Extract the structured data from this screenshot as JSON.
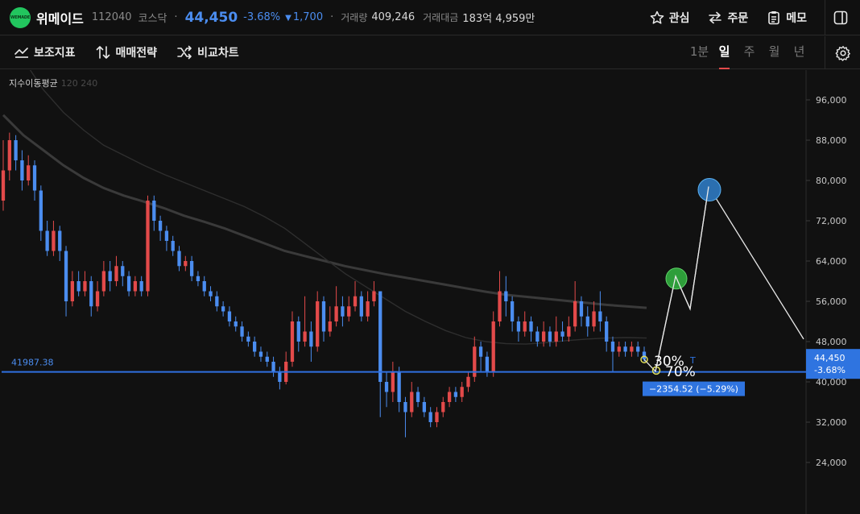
{
  "header": {
    "logo_text": "WEMADE",
    "name": "위메이드",
    "code": "112040",
    "market": "코스닥",
    "price": "44,450",
    "change_rate": "-3.68%",
    "change_arrow": "▼",
    "change_amount": "1,700",
    "volume_label": "거래량",
    "volume": "409,246",
    "turnover_label": "거래대금",
    "turnover": "183억 4,959만",
    "actions": {
      "watch": "관심",
      "order": "주문",
      "memo": "메모"
    }
  },
  "toolbar": {
    "indicators": "보조지표",
    "strategy": "매매전략",
    "compare": "비교차트",
    "periods": [
      "1분",
      "일",
      "주",
      "월",
      "년"
    ],
    "active_period": "일"
  },
  "colors": {
    "up": "#e34a4a",
    "down": "#4b8df0",
    "background": "#111111",
    "hline": "#2f6fe0",
    "ma_long": "#3a3a3a",
    "wave_green": "#2e9e3a",
    "wave_blue": "#2b6fb0"
  },
  "chart_data": {
    "type": "candlestick",
    "legend": {
      "title": "지수이동평균",
      "periods": "120 240"
    },
    "y_axis": {
      "ticks": [
        "96,000",
        "88,000",
        "80,000",
        "72,000",
        "64,000",
        "56,000",
        "48,000",
        "40,000",
        "32,000",
        "24,000"
      ],
      "tick_values": [
        96000,
        88000,
        80000,
        72000,
        64000,
        56000,
        48000,
        40000,
        32000,
        24000
      ],
      "range": [
        20000,
        100000
      ]
    },
    "current_price": {
      "value": 44450,
      "label": "44,450",
      "change": "-3.68%"
    },
    "horizontal_line": {
      "value": 41987.38,
      "label": "41987.38"
    },
    "measure_label": "−2354.52 (−5.29%)",
    "fib_labels": [
      "30%",
      "70%"
    ],
    "projection_path": [
      44450,
      42100,
      61000,
      54500,
      78800,
      48500
    ],
    "ma120": [
      93000,
      89000,
      86000,
      83000,
      80500,
      78500,
      77000,
      75800,
      74500,
      73000,
      71800,
      70500,
      69000,
      67500,
      66000,
      65000,
      64000,
      63000,
      62200,
      61400,
      60700,
      60000,
      59300,
      58600,
      57900,
      57300,
      56900,
      56500,
      56100,
      55700,
      55300,
      55000,
      54700
    ],
    "ma240": [
      112000,
      104000,
      98000,
      93500,
      90000,
      87000,
      85000,
      83000,
      81200,
      79600,
      78000,
      76400,
      74800,
      72800,
      70500,
      67500,
      64500,
      61500,
      59000,
      56500,
      54000,
      52000,
      50200,
      48800,
      48000,
      47600,
      47500,
      47800,
      48200,
      48500,
      48700,
      48800,
      48700
    ],
    "candles": [
      [
        76000,
        82000,
        88000,
        74000
      ],
      [
        82000,
        88000,
        89500,
        80000
      ],
      [
        88000,
        84000,
        89000,
        82000
      ],
      [
        84000,
        80000,
        86000,
        78000
      ],
      [
        80000,
        83000,
        85000,
        79000
      ],
      [
        83000,
        78000,
        84000,
        76000
      ],
      [
        78000,
        70000,
        79000,
        68000
      ],
      [
        70000,
        66000,
        72000,
        65000
      ],
      [
        66000,
        70000,
        72000,
        65000
      ],
      [
        70000,
        66000,
        71000,
        64000
      ],
      [
        66000,
        56000,
        67000,
        53000
      ],
      [
        56000,
        60000,
        62000,
        55000
      ],
      [
        60000,
        58000,
        62000,
        57000
      ],
      [
        58000,
        60000,
        62000,
        57000
      ],
      [
        60000,
        55000,
        61000,
        53000
      ],
      [
        55000,
        58000,
        60000,
        54000
      ],
      [
        58000,
        62000,
        64000,
        57000
      ],
      [
        62000,
        60000,
        64000,
        58000
      ],
      [
        60000,
        63000,
        65000,
        59000
      ],
      [
        63000,
        61000,
        64000,
        59000
      ],
      [
        61000,
        58000,
        62000,
        57000
      ],
      [
        58000,
        60000,
        61000,
        57000
      ],
      [
        60000,
        58000,
        61000,
        57000
      ],
      [
        58000,
        76000,
        77000,
        57000
      ],
      [
        76000,
        72000,
        77000,
        70000
      ],
      [
        72000,
        70000,
        73000,
        68000
      ],
      [
        70000,
        68000,
        71000,
        66000
      ],
      [
        68000,
        66000,
        69000,
        65000
      ],
      [
        66000,
        63000,
        67000,
        62000
      ],
      [
        63000,
        64000,
        65000,
        62000
      ],
      [
        64000,
        61000,
        65000,
        60000
      ],
      [
        61000,
        60000,
        62000,
        59000
      ],
      [
        60000,
        58000,
        61000,
        57000
      ],
      [
        58000,
        57000,
        59000,
        56000
      ],
      [
        57000,
        55000,
        58000,
        54000
      ],
      [
        55000,
        54000,
        56000,
        53000
      ],
      [
        54000,
        52000,
        55000,
        51000
      ],
      [
        52000,
        51000,
        53000,
        50000
      ],
      [
        51000,
        49000,
        52000,
        48000
      ],
      [
        49000,
        48000,
        50000,
        47000
      ],
      [
        48000,
        46000,
        49000,
        45000
      ],
      [
        46000,
        45000,
        47000,
        44000
      ],
      [
        45000,
        44000,
        46000,
        43000
      ],
      [
        44000,
        42000,
        45000,
        41000
      ],
      [
        42000,
        40000,
        43000,
        38500
      ],
      [
        40000,
        44000,
        46000,
        39500
      ],
      [
        44000,
        52000,
        54000,
        43000
      ],
      [
        52000,
        48000,
        53000,
        46000
      ],
      [
        48000,
        50000,
        57000,
        47000
      ],
      [
        50000,
        47000,
        52000,
        44000
      ],
      [
        47000,
        56000,
        58000,
        46000
      ],
      [
        56000,
        50000,
        57000,
        48000
      ],
      [
        50000,
        52000,
        55000,
        49000
      ],
      [
        52000,
        55000,
        59000,
        51000
      ],
      [
        55000,
        53000,
        57000,
        51000
      ],
      [
        53000,
        55000,
        57000,
        52000
      ],
      [
        55000,
        57000,
        60000,
        54000
      ],
      [
        57000,
        53000,
        58000,
        52000
      ],
      [
        53000,
        56000,
        58000,
        52000
      ],
      [
        56000,
        58000,
        60000,
        55000
      ],
      [
        58000,
        40000,
        58000,
        33000
      ],
      [
        40000,
        38000,
        42000,
        35000
      ],
      [
        38000,
        42000,
        44000,
        36000
      ],
      [
        42000,
        36000,
        43000,
        34000
      ],
      [
        36000,
        34000,
        37000,
        29000
      ],
      [
        34000,
        38000,
        40000,
        33000
      ],
      [
        38000,
        36000,
        39000,
        35000
      ],
      [
        36000,
        34000,
        37000,
        33000
      ],
      [
        34000,
        32000,
        35000,
        31000
      ],
      [
        32000,
        34000,
        35000,
        31000
      ],
      [
        34000,
        36000,
        37000,
        33000
      ],
      [
        36000,
        38000,
        39000,
        35000
      ],
      [
        38000,
        37000,
        39000,
        36000
      ],
      [
        37000,
        39000,
        40000,
        36000
      ],
      [
        39000,
        41000,
        42000,
        38000
      ],
      [
        41000,
        47000,
        49000,
        40000
      ],
      [
        47000,
        45000,
        48000,
        42000
      ],
      [
        45000,
        42000,
        46000,
        41000
      ],
      [
        42000,
        52000,
        54000,
        41000
      ],
      [
        52000,
        58000,
        62000,
        51000
      ],
      [
        58000,
        56000,
        61000,
        53000
      ],
      [
        56000,
        52000,
        57000,
        50000
      ],
      [
        52000,
        50000,
        53000,
        48000
      ],
      [
        50000,
        52000,
        54000,
        49000
      ],
      [
        52000,
        50000,
        53000,
        48000
      ],
      [
        50000,
        48000,
        51000,
        47000
      ],
      [
        48000,
        50000,
        52000,
        47000
      ],
      [
        50000,
        48000,
        51000,
        47000
      ],
      [
        48000,
        50000,
        53000,
        47000
      ],
      [
        50000,
        49000,
        52000,
        48000
      ],
      [
        49000,
        51000,
        53000,
        48000
      ],
      [
        51000,
        56000,
        60000,
        50000
      ],
      [
        56000,
        53000,
        57000,
        51000
      ],
      [
        53000,
        51000,
        55000,
        49000
      ],
      [
        51000,
        54000,
        56000,
        50000
      ],
      [
        54000,
        52000,
        58000,
        50000
      ],
      [
        52000,
        48000,
        53000,
        46000
      ],
      [
        48000,
        46000,
        49000,
        42000
      ],
      [
        46000,
        47000,
        48000,
        45000
      ],
      [
        47000,
        46000,
        48000,
        45000
      ],
      [
        46000,
        47000,
        48000,
        45000
      ],
      [
        47000,
        46000,
        48000,
        45000
      ],
      [
        46000,
        44450,
        47000,
        44000
      ]
    ]
  }
}
